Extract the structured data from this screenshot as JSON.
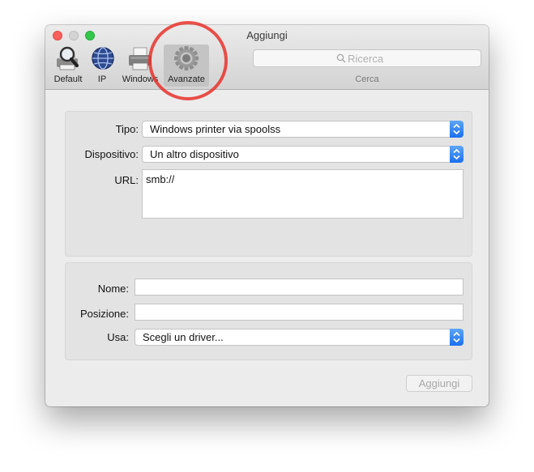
{
  "window": {
    "title": "Aggiungi"
  },
  "toolbar": {
    "items": [
      {
        "label": "Default",
        "icon": "magnifier-printer-icon"
      },
      {
        "label": "IP",
        "icon": "globe-icon"
      },
      {
        "label": "Windows",
        "icon": "printer-icon"
      },
      {
        "label": "Avanzate",
        "icon": "gear-icon",
        "selected": true
      }
    ]
  },
  "search": {
    "placeholder": "Ricerca",
    "caption": "Cerca"
  },
  "connection": {
    "tipo_label": "Tipo:",
    "tipo_value": "Windows printer via spoolss",
    "dispositivo_label": "Dispositivo:",
    "dispositivo_value": "Un altro dispositivo",
    "url_label": "URL:",
    "url_value": "smb://"
  },
  "printer": {
    "nome_label": "Nome:",
    "nome_value": "",
    "posizione_label": "Posizione:",
    "posizione_value": "",
    "usa_label": "Usa:",
    "usa_value": "Scegli un driver..."
  },
  "actions": {
    "add_label": "Aggiungi"
  },
  "colors": {
    "accent": "#1c6ff0",
    "annotation": "#e8332c"
  }
}
